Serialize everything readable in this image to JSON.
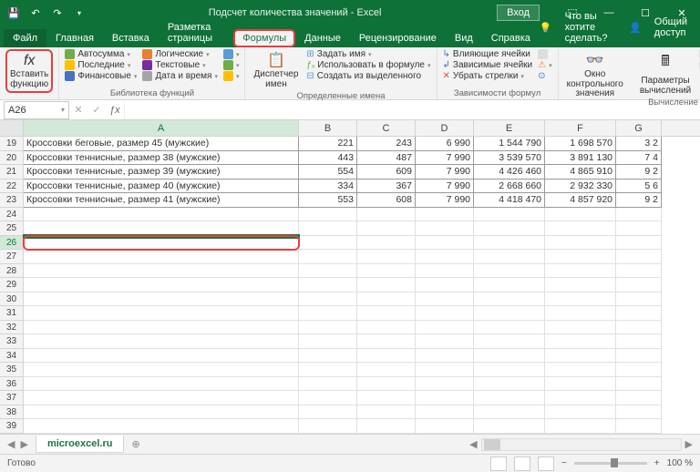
{
  "titlebar": {
    "title": "Подсчет количества значений - Excel",
    "login": "Вход"
  },
  "tabs": {
    "file": "Файл",
    "items": [
      "Главная",
      "Вставка",
      "Разметка страницы",
      "Формулы",
      "Данные",
      "Рецензирование",
      "Вид",
      "Справка"
    ],
    "active": 3,
    "search": "Что вы хотите сделать?",
    "share": "Общий доступ"
  },
  "ribbon": {
    "insert_fn": "Вставить\nфункцию",
    "lib": {
      "autosum": "Автосумма",
      "recent": "Последние",
      "financial": "Финансовые",
      "logical": "Логические",
      "text": "Текстовые",
      "date": "Дата и время",
      "label": "Библиотека функций"
    },
    "name_mgr": {
      "btn": "Диспетчер\nимен",
      "define": "Задать имя",
      "use": "Использовать в формуле",
      "create": "Создать из выделенного",
      "label": "Определенные имена"
    },
    "trace": {
      "prec": "Влияющие ячейки",
      "dep": "Зависимые ячейки",
      "remove": "Убрать стрелки",
      "label": "Зависимости формул"
    },
    "watch": "Окно контрольного\nзначения",
    "calc": {
      "btn": "Параметры\nвычислений",
      "label": "Вычисление"
    }
  },
  "namebox": "A26",
  "columns": [
    "A",
    "B",
    "C",
    "D",
    "E",
    "F",
    "G"
  ],
  "data_rows": [
    {
      "n": 19,
      "a": "Кроссовки беговые, размер 45 (мужские)",
      "b": "221",
      "c": "243",
      "d": "6 990",
      "e": "1 544 790",
      "f": "1 698 570",
      "g": "3 2"
    },
    {
      "n": 20,
      "a": "Кроссовки теннисные, размер 38 (мужские)",
      "b": "443",
      "c": "487",
      "d": "7 990",
      "e": "3 539 570",
      "f": "3 891 130",
      "g": "7 4"
    },
    {
      "n": 21,
      "a": "Кроссовки теннисные, размер 39 (мужские)",
      "b": "554",
      "c": "609",
      "d": "7 990",
      "e": "4 426 460",
      "f": "4 865 910",
      "g": "9 2"
    },
    {
      "n": 22,
      "a": "Кроссовки теннисные, размер 40 (мужские)",
      "b": "334",
      "c": "367",
      "d": "7 990",
      "e": "2 668 660",
      "f": "2 932 330",
      "g": "5 6"
    },
    {
      "n": 23,
      "a": "Кроссовки теннисные, размер 41 (мужские)",
      "b": "553",
      "c": "608",
      "d": "7 990",
      "e": "4 418 470",
      "f": "4 857 920",
      "g": "9 2"
    }
  ],
  "empty_rows": [
    24,
    25,
    26,
    27,
    28,
    29,
    30,
    31,
    32,
    33,
    34,
    35,
    36,
    37,
    38,
    39
  ],
  "selected_row": 26,
  "sheet": {
    "name": "microexcel.ru"
  },
  "statusbar": {
    "ready": "Готово",
    "zoom": "100 %"
  }
}
